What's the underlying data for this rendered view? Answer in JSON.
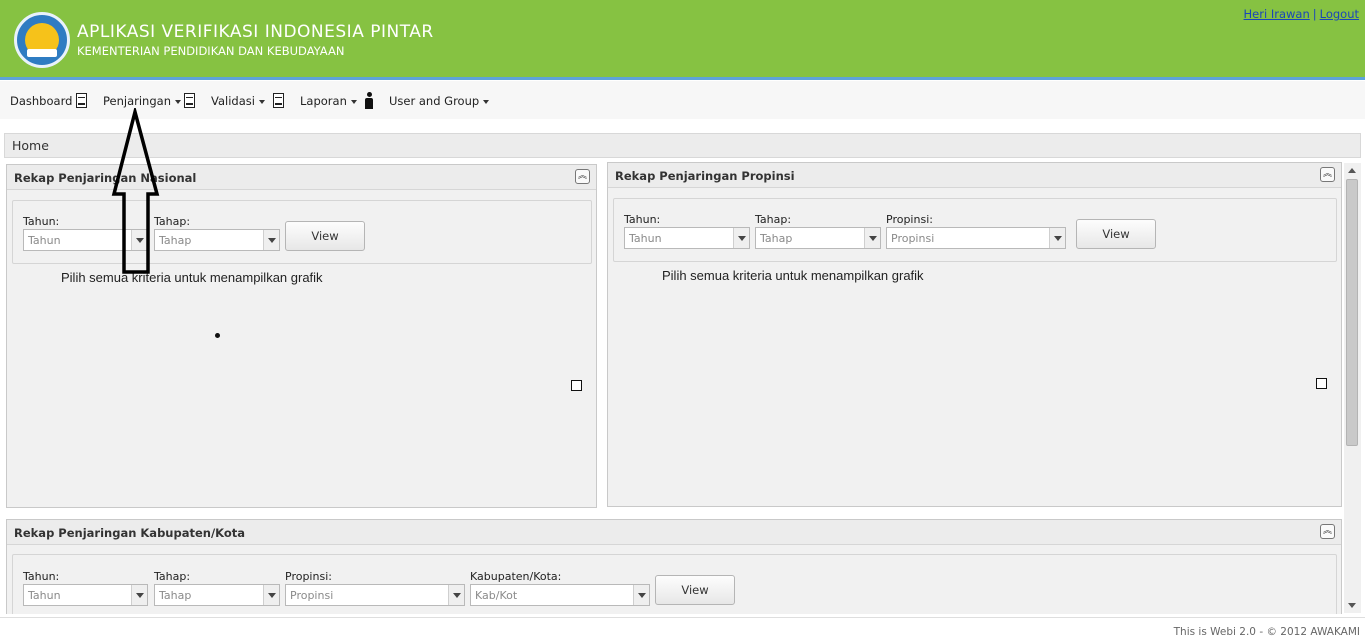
{
  "header": {
    "title": "APLIKASI VERIFIKASI INDONESIA PINTAR",
    "subtitle": "KEMENTERIAN PENDIDIKAN DAN KEBUDAYAAN",
    "user_name": "Heri Irawan",
    "separator": "|",
    "logout": "Logout"
  },
  "menu": {
    "dashboard": "Dashboard",
    "penjaringan": "Penjaringan",
    "validasi": "Validasi",
    "laporan": "Laporan",
    "user_group": "User and Group"
  },
  "breadcrumb": {
    "home": "Home"
  },
  "panels": {
    "nasional": {
      "title": "Rekap Penjaringan Nasional",
      "tahun_label": "Tahun:",
      "tahun_placeholder": "Tahun",
      "tahap_label": "Tahap:",
      "tahap_placeholder": "Tahap",
      "view": "View",
      "hint": "Pilih semua kriteria untuk menampilkan grafik"
    },
    "propinsi": {
      "title": "Rekap Penjaringan Propinsi",
      "tahun_label": "Tahun:",
      "tahun_placeholder": "Tahun",
      "tahap_label": "Tahap:",
      "tahap_placeholder": "Tahap",
      "propinsi_label": "Propinsi:",
      "propinsi_placeholder": "Propinsi",
      "view": "View",
      "hint": "Pilih semua kriteria untuk menampilkan grafik"
    },
    "kabupaten": {
      "title": "Rekap Penjaringan Kabupaten/Kota",
      "tahun_label": "Tahun:",
      "tahun_placeholder": "Tahun",
      "tahap_label": "Tahap:",
      "tahap_placeholder": "Tahap",
      "propinsi_label": "Propinsi:",
      "propinsi_placeholder": "Propinsi",
      "kabkota_label": "Kabupaten/Kota:",
      "kabkota_placeholder": "Kab/Kot",
      "view": "View"
    }
  },
  "footer": {
    "text": "This is Webi 2.0 - © 2012 AWAKAMI"
  },
  "colors": {
    "header_bg": "#86c242",
    "header_border": "#5ea3d9",
    "link": "#1a47b8"
  }
}
